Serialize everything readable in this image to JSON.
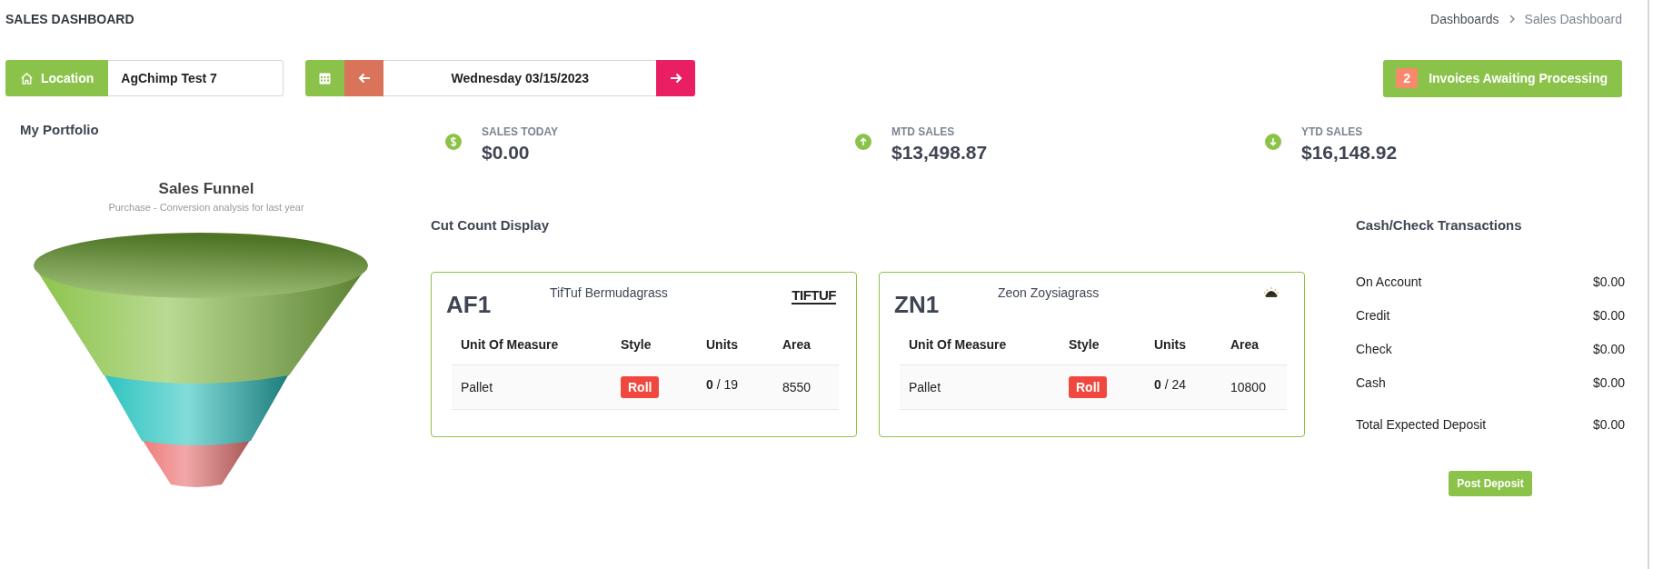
{
  "page_title": "SALES DASHBOARD",
  "breadcrumb": [
    {
      "label": "Dashboards",
      "current": false
    },
    {
      "label": "Sales Dashboard",
      "current": true
    }
  ],
  "location": {
    "label": "Location",
    "value": "AgChimp Test 7"
  },
  "date_picker": {
    "value": "Wednesday 03/15/2023"
  },
  "invoices_button": {
    "count": "2",
    "label": "Invoices Awaiting Processing"
  },
  "portfolio": {
    "title": "My Portfolio",
    "funnel_title": "Sales Funnel",
    "funnel_subtitle": "Purchase - Conversion analysis for last year"
  },
  "stats": [
    {
      "kind": "dollar",
      "label": "SALES TODAY",
      "value": "$0.00"
    },
    {
      "kind": "up",
      "label": "MTD SALES",
      "value": "$13,498.87"
    },
    {
      "kind": "down",
      "label": "YTD SALES",
      "value": "$16,148.92"
    }
  ],
  "cut_count": {
    "title": "Cut Count Display",
    "cards": [
      {
        "code": "AF1",
        "name": "TifTuf Bermudagrass",
        "columns": [
          "Unit Of Measure",
          "Style",
          "Units",
          "Area"
        ],
        "logo": {
          "kind": "text",
          "text": "TIFTUF"
        },
        "rows": [
          {
            "unit": "Pallet",
            "style": "Roll",
            "units": "**0** / 19",
            "area": "8550"
          }
        ]
      },
      {
        "code": "ZN1",
        "name": "Zeon Zoysiagrass",
        "columns": [
          "Unit Of Measure",
          "Style",
          "Units",
          "Area"
        ],
        "logo": {
          "kind": "emblem"
        },
        "rows": [
          {
            "unit": "Pallet",
            "style": "Roll",
            "units": "**0** / 24",
            "area": "10800"
          }
        ]
      }
    ]
  },
  "cash": {
    "title": "Cash/Check Transactions",
    "rows": [
      {
        "kind": "line",
        "label": "On Account",
        "value": "$0.00"
      },
      {
        "kind": "line",
        "label": "Credit",
        "value": "$0.00"
      },
      {
        "kind": "line",
        "label": "Check",
        "value": "$0.00"
      },
      {
        "kind": "line",
        "label": "Cash",
        "value": "$0.00"
      },
      {
        "kind": "total",
        "label": "Total Expected Deposit",
        "value": "$0.00"
      }
    ],
    "button": "Post Deposit"
  }
}
